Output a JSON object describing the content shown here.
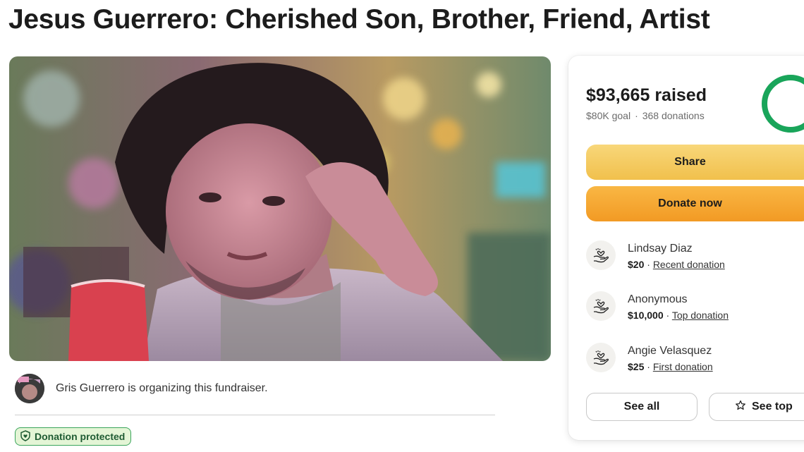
{
  "page": {
    "title": "Jesus Guerrero: Cherished Son, Brother, Friend, Artist"
  },
  "organizer": {
    "text": "Gris Guerrero is organizing this fundraiser."
  },
  "badge": {
    "label": "Donation protected",
    "icon": "shield-heart-icon"
  },
  "progress": {
    "raised": "$93,665 raised",
    "goal": "$80K goal",
    "separator": "·",
    "donations": "368 donations",
    "fraction": 1.0,
    "color": "#19a55a"
  },
  "actions": {
    "share": "Share",
    "donate": "Donate now",
    "see_all": "See all",
    "see_top": "See top"
  },
  "donations": [
    {
      "name": "Lindsay Diaz",
      "amount": "$20",
      "sep": " · ",
      "tag": "Recent donation",
      "icon": "hand-heart-icon"
    },
    {
      "name": "Anonymous",
      "amount": "$10,000",
      "sep": " · ",
      "tag": "Top donation",
      "icon": "hand-heart-icon"
    },
    {
      "name": "Angie Velasquez",
      "amount": "$25",
      "sep": " · ",
      "tag": "First donation",
      "icon": "hand-heart-icon"
    }
  ],
  "colors": {
    "share_button": "#f3c956",
    "donate_button": "#f5a530",
    "badge_bg": "#e4f5d6",
    "badge_border": "#3aa55b"
  }
}
